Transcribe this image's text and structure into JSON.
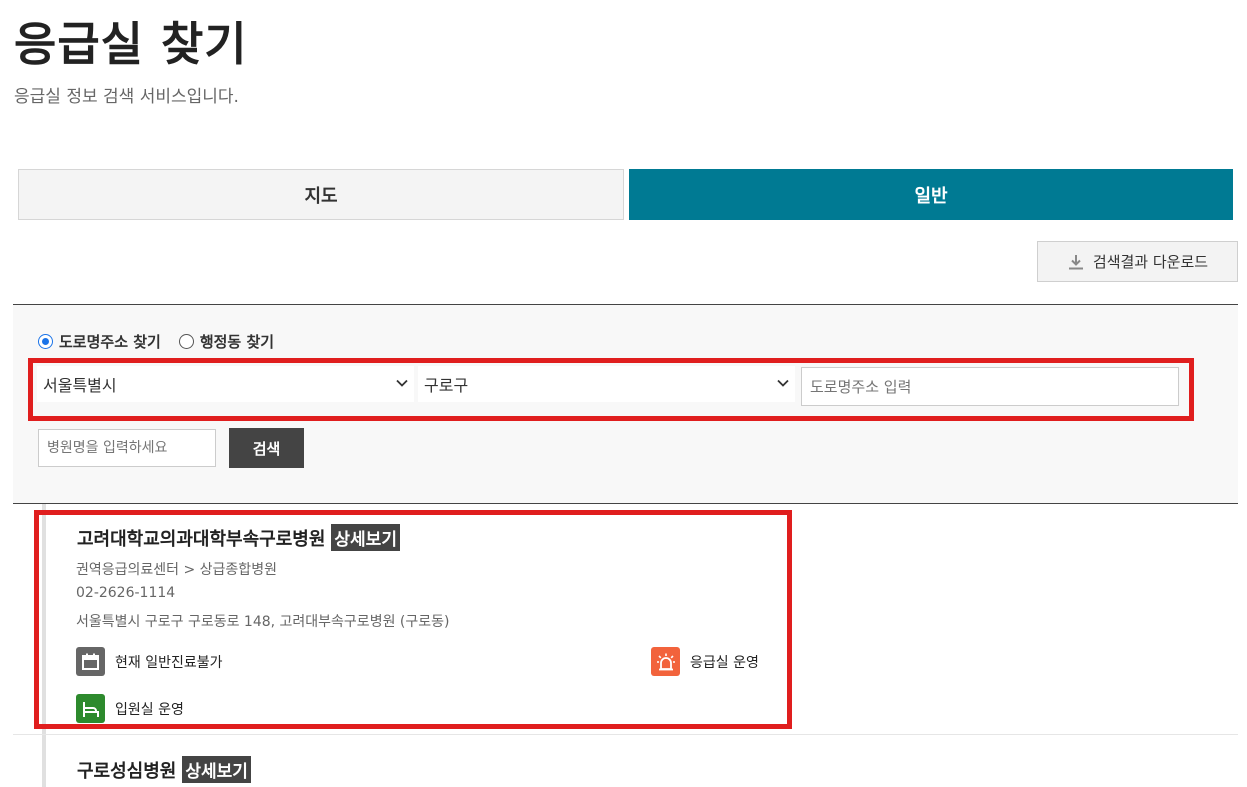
{
  "header": {
    "title": "응급실 찾기",
    "subtitle": "응급실 정보 검색 서비스입니다."
  },
  "tabs": [
    {
      "label": "지도",
      "active": false
    },
    {
      "label": "일반",
      "active": true
    }
  ],
  "download": {
    "label": "검색결과 다운로드",
    "icon": "download-icon"
  },
  "search": {
    "radio_road": "도로명주소 찾기",
    "radio_dong": "행정동 찾기",
    "selected_radio": "도로명주소 찾기",
    "city_value": "서울특별시",
    "district_value": "구로구",
    "road_placeholder": "도로명주소 입력",
    "hospital_placeholder": "병원명을 입력하세요",
    "search_label": "검색"
  },
  "results": [
    {
      "name": "고려대학교의과대학부속구로병원",
      "detail_label": "상세보기",
      "category": "권역응급의료센터 > 상급종합병원",
      "phone": "02-2626-1114",
      "address": "서울특별시 구로구 구로동로 148, 고려대부속구로병원 (구로동)",
      "status_general": "현재 일반진료불가",
      "status_er": "응급실 운영",
      "status_ward": "입원실 운영"
    },
    {
      "name": "구로성심병원",
      "detail_label": "상세보기"
    }
  ],
  "colors": {
    "tab_active": "#007a93",
    "highlight": "#e01e1e",
    "dark_button": "#444444",
    "icon_general": "#666666",
    "icon_er": "#f2633c",
    "icon_ward": "#2d8a2d"
  }
}
